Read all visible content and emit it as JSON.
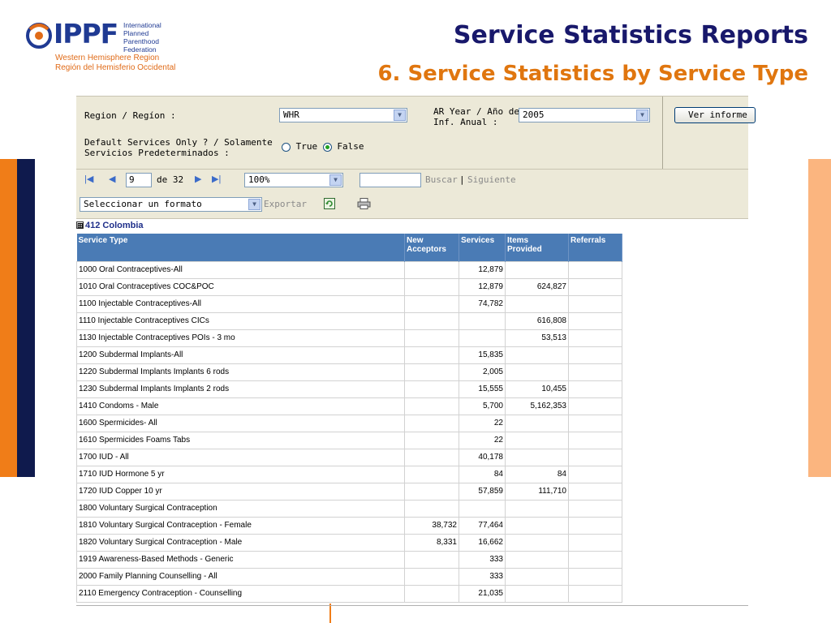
{
  "logo": {
    "brand": "IPPF",
    "fullname_lines": [
      "International",
      "Planned Parenthood",
      "Federation"
    ],
    "region_en": "Western Hemisphere Region",
    "region_es": "Región del Hemisferio Occidental"
  },
  "slide": {
    "title": "Service Statistics Reports",
    "subtitle": "6. Service Statistics by Service Type"
  },
  "params": {
    "region_label": "Region / Regíon :",
    "region_value": "WHR",
    "year_label_1": "AR Year / Año de",
    "year_label_2": "Inf. Anual :",
    "year_value": "2005",
    "default_label_1": "Default Services Only ? / Solamente",
    "default_label_2": "Servicios Predeterminados :",
    "radio_true": "True",
    "radio_false": "False",
    "radio_selected": "False",
    "view_button": "Ver informe"
  },
  "toolbar": {
    "page_current": "9",
    "page_of": "de 32",
    "zoom": "100%",
    "find_placeholder": "",
    "find_link": "Buscar",
    "find_sep": "|",
    "next_link": "Siguiente",
    "format_select": "Seleccionar un formato",
    "export_link": "Exportar",
    "icons": [
      "first-page-icon",
      "prev-page-icon",
      "next-page-icon",
      "last-page-icon",
      "refresh-icon",
      "print-icon"
    ]
  },
  "report": {
    "group_toggle": "⊞",
    "group_label": "412 Colombia",
    "columns": [
      {
        "line1": "Service Type",
        "line2": ""
      },
      {
        "line1": "New",
        "line2": "Acceptors"
      },
      {
        "line1": "Services",
        "line2": ""
      },
      {
        "line1": "Items",
        "line2": "Provided"
      },
      {
        "line1": "Referrals",
        "line2": ""
      }
    ],
    "rows": [
      {
        "type": "1000 Oral Contraceptives-All",
        "new": "",
        "services": "12,879",
        "items": "",
        "referrals": ""
      },
      {
        "type": "1010 Oral Contraceptives COC&POC",
        "new": "",
        "services": "12,879",
        "items": "624,827",
        "referrals": ""
      },
      {
        "type": "1100 Injectable Contraceptives-All",
        "new": "",
        "services": "74,782",
        "items": "",
        "referrals": ""
      },
      {
        "type": "1110 Injectable Contraceptives CICs",
        "new": "",
        "services": "",
        "items": "616,808",
        "referrals": ""
      },
      {
        "type": "1130 Injectable Contraceptives POIs - 3 mo",
        "new": "",
        "services": "",
        "items": "53,513",
        "referrals": ""
      },
      {
        "type": "1200 Subdermal Implants-All",
        "new": "",
        "services": "15,835",
        "items": "",
        "referrals": ""
      },
      {
        "type": "1220 Subdermal Implants Implants 6 rods",
        "new": "",
        "services": "2,005",
        "items": "",
        "referrals": ""
      },
      {
        "type": "1230 Subdermal Implants Implants 2 rods",
        "new": "",
        "services": "15,555",
        "items": "10,455",
        "referrals": ""
      },
      {
        "type": "1410 Condoms - Male",
        "new": "",
        "services": "5,700",
        "items": "5,162,353",
        "referrals": ""
      },
      {
        "type": "1600 Spermicides- All",
        "new": "",
        "services": "22",
        "items": "",
        "referrals": ""
      },
      {
        "type": "1610 Spermicides Foams Tabs",
        "new": "",
        "services": "22",
        "items": "",
        "referrals": ""
      },
      {
        "type": "1700 IUD - All",
        "new": "",
        "services": "40,178",
        "items": "",
        "referrals": ""
      },
      {
        "type": "1710 IUD Hormone 5 yr",
        "new": "",
        "services": "84",
        "items": "84",
        "referrals": ""
      },
      {
        "type": "1720 IUD Copper 10 yr",
        "new": "",
        "services": "57,859",
        "items": "111,710",
        "referrals": ""
      },
      {
        "type": "1800 Voluntary Surgical Contraception",
        "new": "",
        "services": "",
        "items": "",
        "referrals": ""
      },
      {
        "type": "1810 Voluntary Surgical Contraception - Female",
        "new": "38,732",
        "services": "77,464",
        "items": "",
        "referrals": ""
      },
      {
        "type": "1820 Voluntary Surgical Contraception - Male",
        "new": "8,331",
        "services": "16,662",
        "items": "",
        "referrals": ""
      },
      {
        "type": "1919 Awareness-Based Methods - Generic",
        "new": "",
        "services": "333",
        "items": "",
        "referrals": ""
      },
      {
        "type": "2000 Family Planning Counselling - All",
        "new": "",
        "services": "333",
        "items": "",
        "referrals": ""
      },
      {
        "type": "2110 Emergency Contraception - Counselling",
        "new": "",
        "services": "21,035",
        "items": "",
        "referrals": ""
      }
    ]
  },
  "colors": {
    "title": "#18186b",
    "subtitle": "#e0760f",
    "header_bg": "#4a7bb5",
    "bar_orange": "#f07d18",
    "bar_navy": "#0f1a4d",
    "bar_peach": "#fbb57f"
  }
}
